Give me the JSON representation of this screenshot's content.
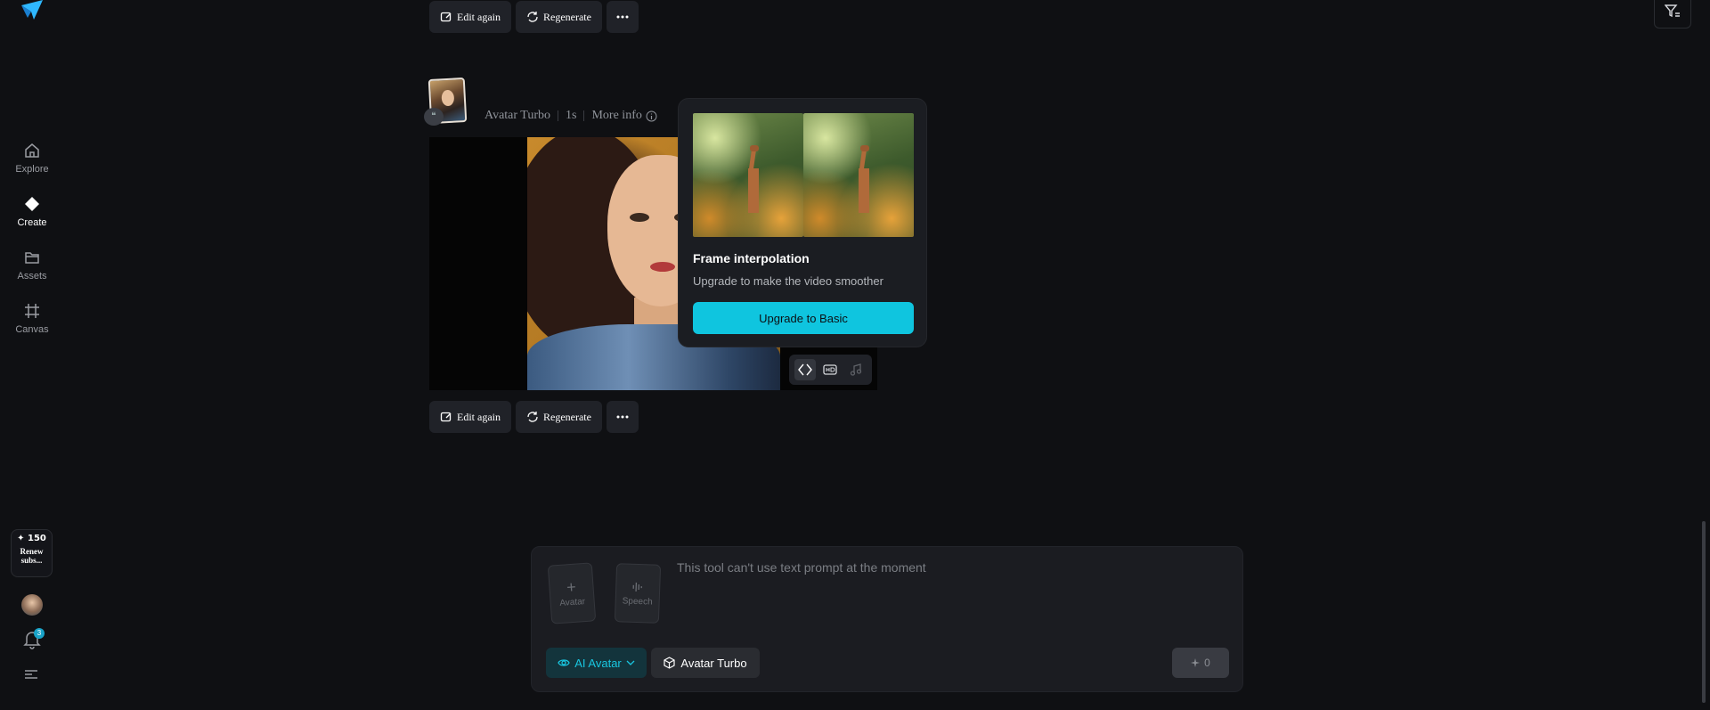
{
  "sidebar": {
    "items": [
      {
        "label": "Explore",
        "icon": "home-icon"
      },
      {
        "label": "Create",
        "icon": "diamond-icon"
      },
      {
        "label": "Assets",
        "icon": "folder-icon"
      },
      {
        "label": "Canvas",
        "icon": "frame-icon"
      }
    ],
    "credits": {
      "value": "✦ 150",
      "label": "Renew subs..."
    },
    "notification_count": "3"
  },
  "actions": {
    "edit_again": "Edit again",
    "regenerate": "Regenerate"
  },
  "generation": {
    "model": "Avatar Turbo",
    "duration": "1s",
    "more_info": "More info"
  },
  "popover": {
    "title": "Frame interpolation",
    "description": "Upgrade to make the video smoother",
    "button": "Upgrade to Basic"
  },
  "prompt": {
    "avatar_slot": "Avatar",
    "speech_slot": "Speech",
    "placeholder": "This tool can't use text prompt at the moment",
    "mode": "AI Avatar",
    "model": "Avatar Turbo",
    "cost": "0"
  },
  "colors": {
    "accent": "#0fc5df",
    "background": "#0f1013",
    "panel": "#1b1c21"
  }
}
